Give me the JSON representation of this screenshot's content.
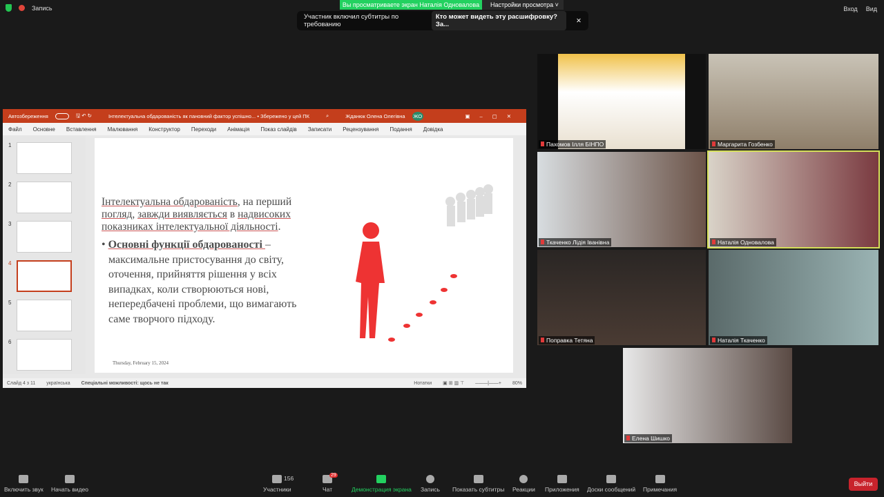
{
  "top": {
    "recording": "Запись",
    "banner": "Вы просматриваете экран Наталія Одновалова",
    "view_settings": "Настройки просмотра",
    "notice": "Участник включил субтитры по требованию",
    "notice_link": "Кто может видеть эту расшифровку? За...",
    "signin": "Вход",
    "view": "Вид"
  },
  "ppt": {
    "autosave": "Автозбереження",
    "doc_title": "Інтелектуальна обдарованість як пановний фактор успішно... • Збережено у цей ПК",
    "user": "Жданюк Олена Олегівна",
    "initials": "ЖО",
    "menu": [
      "Файл",
      "Основне",
      "Вставлення",
      "Малювання",
      "Конструктор",
      "Переходи",
      "Анімація",
      "Показ слайдів",
      "Записати",
      "Рецензування",
      "Подання",
      "Довідка"
    ],
    "thumbs": [
      "1",
      "2",
      "3",
      "4",
      "5",
      "6"
    ],
    "slide": {
      "p1a": "Інтелектуальна обдарованість",
      "p1b": ", на перший ",
      "p1c": "погляд",
      "p1d": ", ",
      "p1e": "завжди виявляється",
      "p1f": " в ",
      "p1g": "надвисоких показниках інтелектуальної діяльності",
      "p1h": ".",
      "b_title": "Основні функції обдарованості ",
      "b_text": "– максимальне пристосування до світу, оточення, прийняття рішення у всіх випадках, коли створюються нові, непередбачені проблеми, що вимагають саме творчого підходу.",
      "date": "Thursday, February 15, 2024"
    },
    "status": {
      "slide": "Слайд 4 з 11",
      "lang": "українська",
      "access": "Спеціальні можливості: щось не так",
      "notes": "Нотатки",
      "zoom": "80%"
    }
  },
  "participants": [
    "Пахомов Ілля БІНПО",
    "Маргарита Гозбенко",
    "Ткаченко Лідія Іванівна",
    "Наталія Одновалова",
    "Поправка Тетяна",
    "Наталія Ткаченко",
    "Елена Шишко"
  ],
  "toolbar": {
    "audio": "Включить звук",
    "video": "Начать видео",
    "participants": "Участники",
    "participants_count": "156",
    "chat": "Чат",
    "chat_badge": "29",
    "share": "Демонстрация экрана",
    "record": "Запись",
    "captions": "Показать субтитры",
    "reactions": "Реакции",
    "apps": "Приложения",
    "whiteboards": "Доски сообщений",
    "notes": "Примечания",
    "leave": "Выйти"
  }
}
